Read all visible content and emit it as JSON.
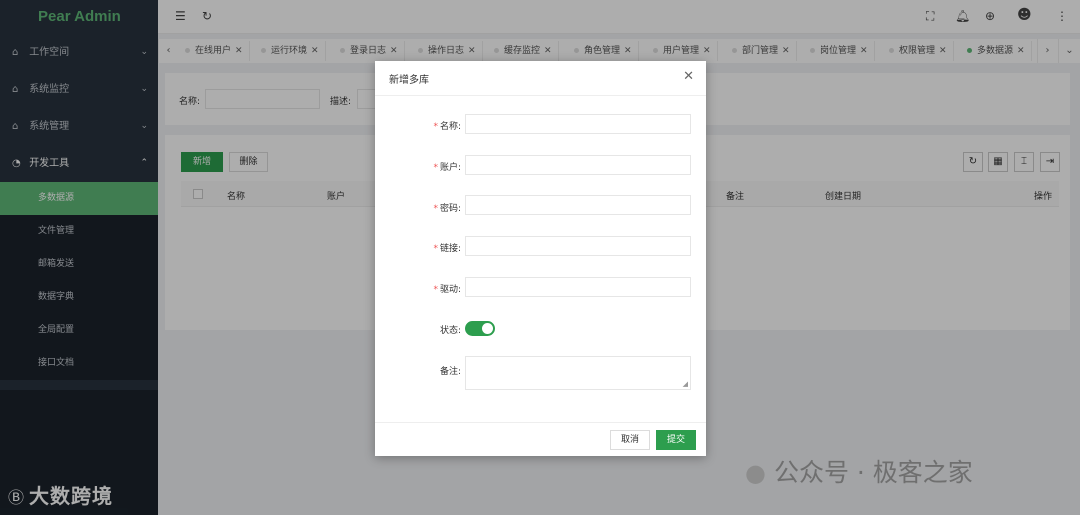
{
  "app": {
    "logo_text": "Pear Admin"
  },
  "sidebar": {
    "groups": [
      {
        "label": "工作空间",
        "icon": "home-icon"
      },
      {
        "label": "系统监控",
        "icon": "home-icon"
      },
      {
        "label": "系统管理",
        "icon": "home-icon"
      },
      {
        "label": "开发工具",
        "icon": "dashboard-icon"
      }
    ],
    "sub_items": [
      {
        "label": "多数据源",
        "active": true
      },
      {
        "label": "文件管理"
      },
      {
        "label": "邮箱发送"
      },
      {
        "label": "数据字典"
      },
      {
        "label": "全局配置"
      },
      {
        "label": "接口文档"
      }
    ],
    "brand_logo": "Ⓑ",
    "brand_text": "大数跨境"
  },
  "tabs": [
    {
      "label": "在线用户"
    },
    {
      "label": "运行环境"
    },
    {
      "label": "登录日志"
    },
    {
      "label": "操作日志"
    },
    {
      "label": "缓存监控"
    },
    {
      "label": "角色管理"
    },
    {
      "label": "用户管理"
    },
    {
      "label": "部门管理"
    },
    {
      "label": "岗位管理"
    },
    {
      "label": "权限管理"
    },
    {
      "label": "多数据源",
      "active": true
    }
  ],
  "search": {
    "name_label": "名称:",
    "desc_label": "描述:"
  },
  "toolbar": {
    "add_label": "新增",
    "delete_label": "删除"
  },
  "table": {
    "columns": [
      "名称",
      "账户",
      "备注",
      "创建日期",
      "操作"
    ]
  },
  "modal": {
    "title": "新增多库",
    "fields": [
      {
        "label": "名称:",
        "required": true
      },
      {
        "label": "账户:",
        "required": true
      },
      {
        "label": "密码:",
        "required": true
      },
      {
        "label": "链接:",
        "required": true
      },
      {
        "label": "驱动:",
        "required": true
      }
    ],
    "status_label": "状态:",
    "status_on": true,
    "remark_label": "备注:",
    "cancel_label": "取消",
    "submit_label": "提交"
  },
  "watermark": {
    "text": "公众号 · 极客之家"
  },
  "colors": {
    "accent": "#2d9e4e",
    "sidebar_bg": "#28333e",
    "logo": "#5fb878"
  }
}
